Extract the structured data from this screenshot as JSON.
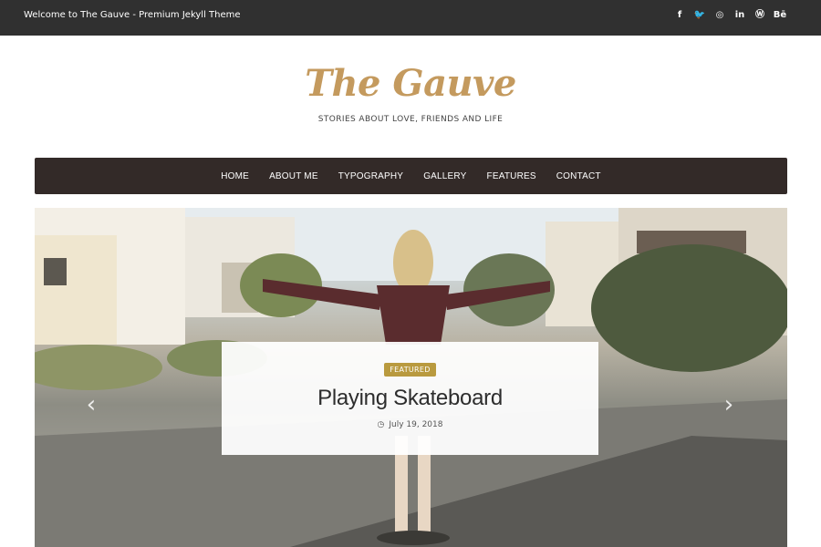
{
  "topbar": {
    "welcome": "Welcome to The Gauve - Premium Jekyll Theme",
    "social": [
      {
        "icon": "facebook-icon",
        "glyph": "f"
      },
      {
        "icon": "twitter-icon",
        "glyph": "🐦"
      },
      {
        "icon": "instagram-icon",
        "glyph": "◎"
      },
      {
        "icon": "linkedin-icon",
        "glyph": "in"
      },
      {
        "icon": "wordpress-icon",
        "glyph": "Ⓦ"
      },
      {
        "icon": "behance-icon",
        "glyph": "Bē"
      }
    ]
  },
  "brand": {
    "title": "The Gauve",
    "tagline": "STORIES ABOUT LOVE, FRIENDS AND LIFE",
    "title_color": "#c49a5e"
  },
  "nav": {
    "items": [
      "HOME",
      "ABOUT ME",
      "TYPOGRAPHY",
      "GALLERY",
      "FEATURES",
      "CONTACT"
    ],
    "background": "#332a28"
  },
  "slider": {
    "prev_glyph": "‹",
    "next_glyph": "›",
    "badge": "FEATURED",
    "badge_color": "#b99a3f",
    "title": "Playing Skateboard",
    "date": "July 19, 2018",
    "clock_glyph": "◷"
  }
}
